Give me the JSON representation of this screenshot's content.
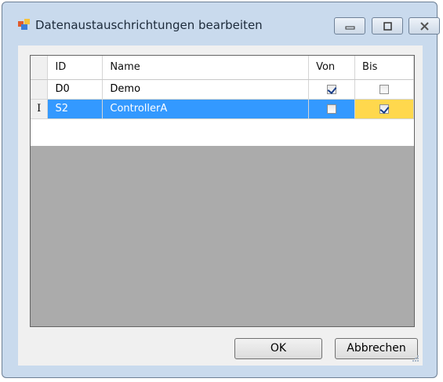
{
  "window": {
    "title": "Datenaustauschrichtungen bearbeiten"
  },
  "grid": {
    "headers": {
      "id": "ID",
      "name": "Name",
      "von": "Von",
      "bis": "Bis"
    },
    "rows": [
      {
        "id": "D0",
        "name": "Demo",
        "von": true,
        "bis": false,
        "selected": false
      },
      {
        "id": "S2",
        "name": "ControllerA",
        "von": false,
        "bis": true,
        "selected": true
      }
    ],
    "edit_marker": "I"
  },
  "buttons": {
    "ok": "OK",
    "cancel": "Abbrechen"
  },
  "colors": {
    "selection": "#3399ff",
    "active_cell": "#ffd84d",
    "frame": "#c9daed"
  }
}
